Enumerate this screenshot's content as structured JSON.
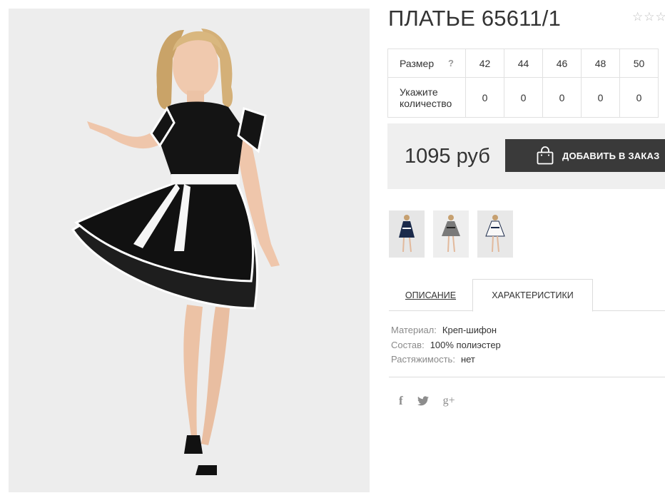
{
  "product": {
    "title": "ПЛАТЬЕ 65611/1",
    "rating_stars": "☆☆☆"
  },
  "size_table": {
    "size_label": "Размер",
    "help": "?",
    "sizes": [
      "42",
      "44",
      "46",
      "48",
      "50"
    ],
    "qty_label": "Укажите количество",
    "quantities": [
      "0",
      "0",
      "0",
      "0",
      "0"
    ]
  },
  "price": {
    "value": "1095 руб",
    "add_button": "ДОБАВИТЬ В ЗАКАЗ"
  },
  "thumbnails": [
    "photo-navy-dress",
    "photo-grey-dress",
    "photo-white-dress"
  ],
  "tabs": {
    "description": "ОПИСАНИЕ",
    "characteristics": "ХАРАКТЕРИСТИКИ",
    "active": "characteristics"
  },
  "characteristics": [
    {
      "key": "Материал:",
      "value": "Креп-шифон"
    },
    {
      "key": "Состав:",
      "value": "100% полиэстер"
    },
    {
      "key": "Растяжимость:",
      "value": "нет"
    }
  ],
  "social": {
    "facebook": "f",
    "googleplus": "g+"
  },
  "colors": {
    "button": "#3a3a3a",
    "price_bg": "#efefef",
    "border": "#e1e1e1"
  }
}
